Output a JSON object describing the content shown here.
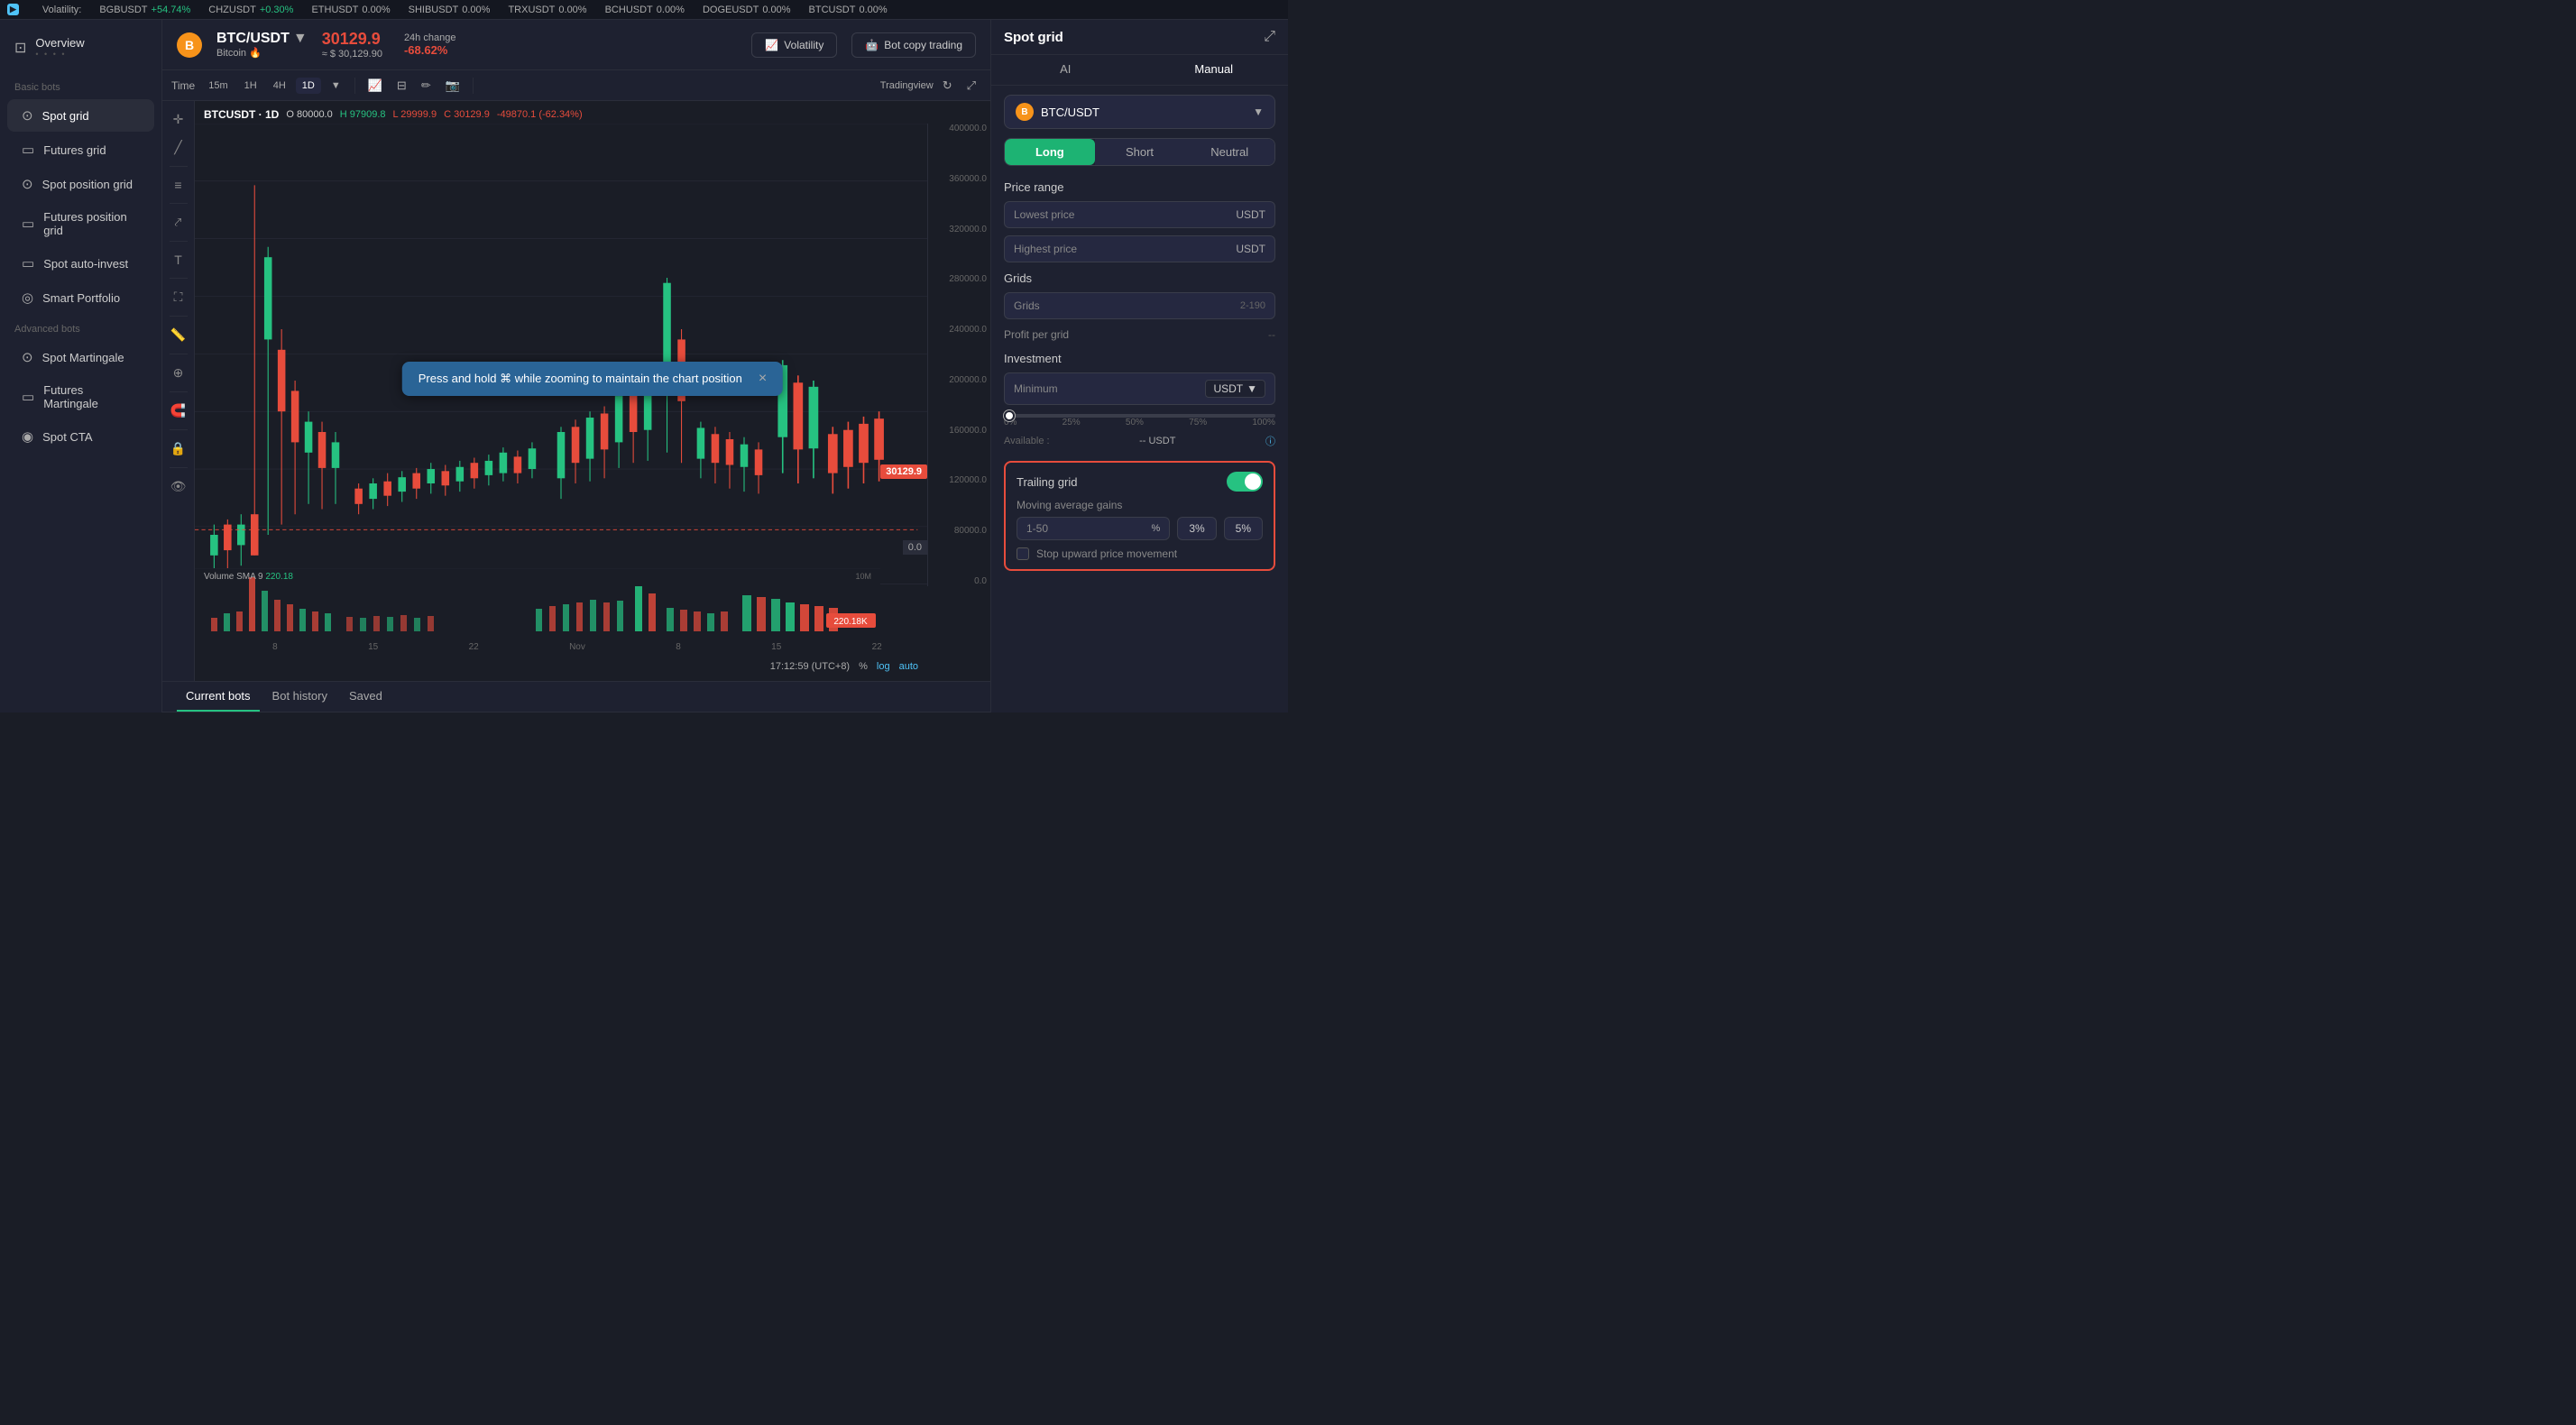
{
  "ticker": {
    "arrow_icon": "▶",
    "volatility_label": "Volatility:",
    "items": [
      {
        "symbol": "BGBUSDT",
        "change": "+54.74%",
        "type": "positive"
      },
      {
        "symbol": "CHZUSDT",
        "change": "+0.30%",
        "type": "positive"
      },
      {
        "symbol": "ETHUSDT",
        "change": "0.00%",
        "type": "neutral"
      },
      {
        "symbol": "SHIBUSDT",
        "change": "0.00%",
        "type": "neutral"
      },
      {
        "symbol": "TRXUSDT",
        "change": "0.00%",
        "type": "neutral"
      },
      {
        "symbol": "BCHUSDT",
        "change": "0.00%",
        "type": "neutral"
      },
      {
        "symbol": "DOGEUSDT",
        "change": "0.00%",
        "type": "neutral"
      },
      {
        "symbol": "BTCUSDT",
        "change": "0.00%",
        "type": "neutral"
      }
    ]
  },
  "sidebar": {
    "overview_label": "Overview",
    "overview_dots": ".....",
    "basic_bots_label": "Basic bots",
    "advanced_bots_label": "Advanced bots",
    "basic_items": [
      {
        "id": "spot-grid",
        "label": "Spot grid",
        "icon": "⊙",
        "active": true
      },
      {
        "id": "futures-grid",
        "label": "Futures grid",
        "icon": "▭"
      },
      {
        "id": "spot-position-grid",
        "label": "Spot position grid",
        "icon": "⊙"
      },
      {
        "id": "futures-position-grid",
        "label": "Futures position grid",
        "icon": "▭"
      },
      {
        "id": "spot-auto-invest",
        "label": "Spot auto-invest",
        "icon": "▭"
      },
      {
        "id": "smart-portfolio",
        "label": "Smart Portfolio",
        "icon": "◎"
      }
    ],
    "advanced_items": [
      {
        "id": "spot-martingale",
        "label": "Spot Martingale",
        "icon": "⊙"
      },
      {
        "id": "futures-martingale",
        "label": "Futures Martingale",
        "icon": "▭"
      },
      {
        "id": "spot-cta",
        "label": "Spot CTA",
        "icon": "◉"
      }
    ]
  },
  "chart_header": {
    "coin_symbol": "B",
    "pair_name": "BTC/USDT",
    "pair_arrow": "▼",
    "pair_sub": "Bitcoin",
    "fire_icon": "🔥",
    "price_main": "30129.9",
    "price_usd": "≈ $ 30,129.90",
    "change_label": "24h change",
    "change_value": "-68.62%",
    "volatility_btn": "Volatility",
    "bot_copy_btn": "Bot copy trading",
    "volatility_icon": "📈",
    "bot_icon": "🤖"
  },
  "chart_toolbar": {
    "time_label": "Time",
    "intervals": [
      "15m",
      "1H",
      "4H",
      "1D"
    ],
    "active_interval": "1D",
    "tradingview_label": "Tradingview"
  },
  "chart": {
    "ohlc_symbol": "BTCUSDT · 1D",
    "ohlc_o_label": "O",
    "ohlc_o_val": "80000.0",
    "ohlc_h_label": "H",
    "ohlc_h_val": "97909.8",
    "ohlc_l_label": "L",
    "ohlc_l_val": "29999.9",
    "ohlc_c_label": "C",
    "ohlc_c_val": "30129.9",
    "ohlc_change": "-49870.1 (-62.34%)",
    "price_scale": [
      "400000.0",
      "360000.0",
      "320000.0",
      "280000.0",
      "240000.0",
      "200000.0",
      "160000.0",
      "120000.0",
      "80000.0",
      "0.0"
    ],
    "volume_label": "Volume SMA 9",
    "volume_val": "220.18",
    "volume_badge": "220.18K",
    "price_line_val": "30129.9",
    "zero_line": "0.0",
    "timestamp": "17:12:59 (UTC+8)",
    "percent_btn": "%",
    "log_btn": "log",
    "auto_btn": "auto",
    "x_labels": [
      "8",
      "15",
      "22",
      "Nov",
      "8",
      "15",
      "22"
    ]
  },
  "tooltip": {
    "text": "Press and hold ⌘ while zooming to maintain the chart position",
    "close_icon": "×"
  },
  "tabs": {
    "items": [
      "Current bots",
      "Bot history",
      "Saved"
    ],
    "active": "Current bots"
  },
  "right_panel": {
    "title": "Spot grid",
    "expand_icon": "⤢",
    "ai_tab": "AI",
    "manual_tab": "Manual",
    "active_tab": "Manual",
    "currency": {
      "coin": "B",
      "name": "BTC/USDT",
      "arrow": "▼"
    },
    "directions": {
      "long": "Long",
      "short": "Short",
      "neutral": "Neutral",
      "active": "long"
    },
    "price_range": {
      "title": "Price range",
      "lowest_placeholder": "Lowest price",
      "lowest_unit": "USDT",
      "highest_placeholder": "Highest price",
      "highest_unit": "USDT"
    },
    "grids": {
      "title": "Grids",
      "placeholder": "Grids",
      "range": "2-190",
      "profit_label": "Profit per grid",
      "profit_value": "--"
    },
    "investment": {
      "title": "Investment",
      "placeholder": "Minimum",
      "unit": "USDT",
      "percent_labels": [
        "0%",
        "25%",
        "50%",
        "75%",
        "100%"
      ],
      "available_label": "Available :",
      "available_value": "-- USDT"
    },
    "trailing": {
      "title": "Trailing grid",
      "toggle_on": true,
      "moving_avg_label": "Moving average gains",
      "ma_range": "1-50",
      "ma_unit": "%",
      "ma_val1": "3%",
      "ma_val2": "5%",
      "stop_label": "Stop upward price movement"
    }
  }
}
